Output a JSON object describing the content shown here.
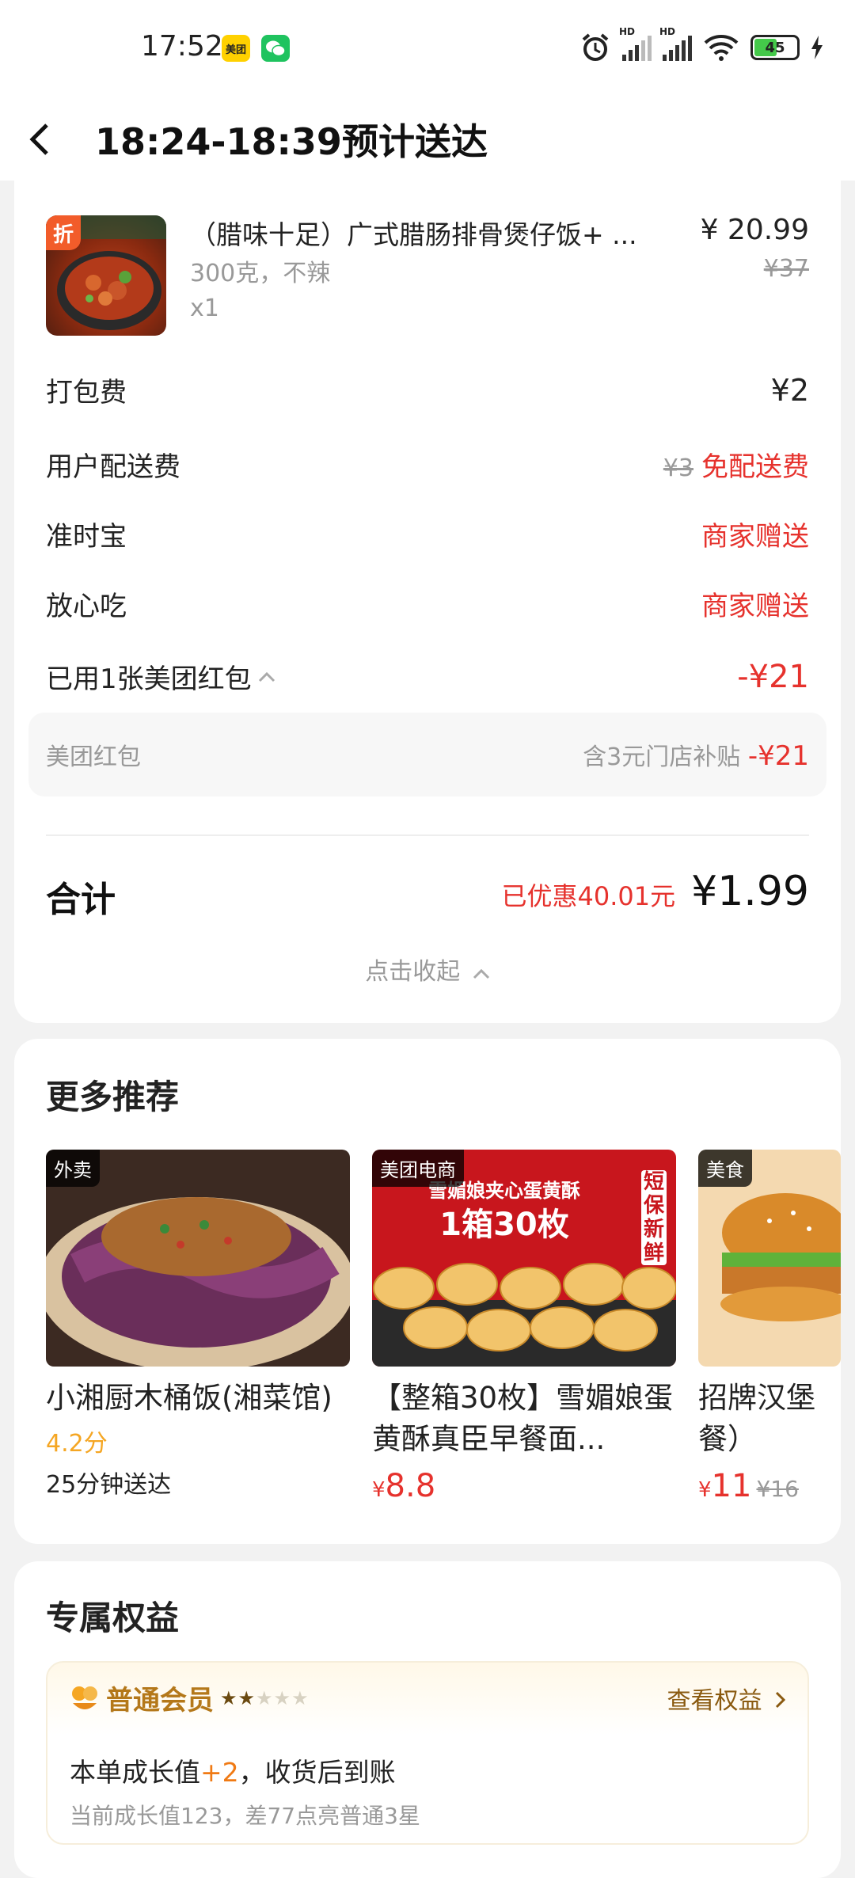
{
  "status_bar": {
    "time": "17:52",
    "app1": "美团",
    "battery": "45",
    "hd1": "HD",
    "hd2": "HD"
  },
  "header": {
    "title": "18:24-18:39预计送达"
  },
  "order": {
    "product": {
      "tag": "折",
      "name": "（腊味十足）广式腊肠排骨煲仔饭+ ...",
      "spec": "300克，不辣",
      "qty": "x1",
      "price": "¥ 20.99",
      "orig_price": "¥37"
    },
    "fees": [
      {
        "label": "打包费",
        "value": "¥2"
      },
      {
        "label": "用户配送费",
        "orig": "¥3",
        "value": "免配送费"
      },
      {
        "label": "准时宝",
        "value": "商家赠送"
      },
      {
        "label": "放心吃",
        "value": "商家赠送"
      },
      {
        "label": "已用1张美团红包",
        "value": "-¥21"
      }
    ],
    "coupon": {
      "label": "美团红包",
      "note": "含3元门店补贴",
      "value": "-¥21"
    },
    "total": {
      "label": "合计",
      "saved": "已优惠40.01元",
      "price": "¥1.99"
    },
    "collapse": "点击收起"
  },
  "recommend": {
    "title": "更多推荐",
    "items": [
      {
        "badge": "外卖",
        "name": "小湘厨木桶饭(湘菜馆)",
        "score": "4.2分",
        "eta": "25分钟送达"
      },
      {
        "badge": "美团电商",
        "name": "【整箱30枚】雪媚娘蛋黄酥真臣早餐面...",
        "price_symbol": "¥",
        "price": "8.8",
        "img_text1": "雪媚娘夹心蛋黄酥",
        "img_text2": "1箱30枚",
        "img_text3": "短保新鲜"
      },
      {
        "badge": "美食",
        "name": "招牌汉堡餐）",
        "price_symbol": "¥",
        "price": "11",
        "orig": "¥16"
      }
    ]
  },
  "benefits": {
    "title": "专属权益",
    "level": "普通会员",
    "stars_on": "★★",
    "stars_off": "★★★",
    "link": "查看权益",
    "line1_a": "本单成长值",
    "line1_b": "+2",
    "line1_c": "，收货后到账",
    "line2": "当前成长值123，差77点亮普通3星"
  }
}
